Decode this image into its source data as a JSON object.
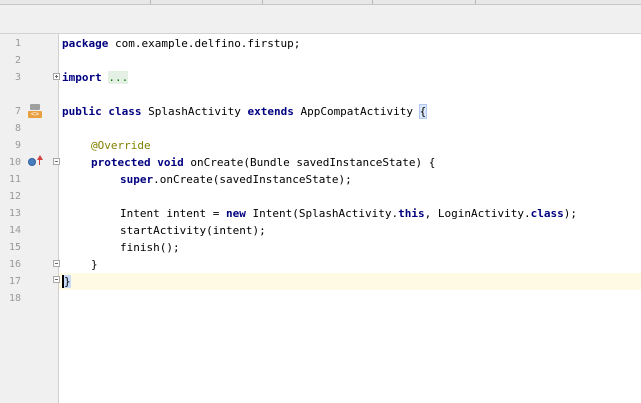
{
  "editor": {
    "lines": [
      {
        "n": "1",
        "code": "package com.example.delfino.firstup;"
      },
      {
        "n": "2",
        "code": ""
      },
      {
        "n": "3",
        "code": "import ..."
      },
      {
        "n": "7",
        "code": "public class SplashActivity extends AppCompatActivity {"
      },
      {
        "n": "8",
        "code": ""
      },
      {
        "n": "9",
        "code": "    @Override"
      },
      {
        "n": "10",
        "code": "    protected void onCreate(Bundle savedInstanceState) {"
      },
      {
        "n": "11",
        "code": "        super.onCreate(savedInstanceState);"
      },
      {
        "n": "12",
        "code": ""
      },
      {
        "n": "13",
        "code": "        Intent intent = new Intent(SplashActivity.this, LoginActivity.class);"
      },
      {
        "n": "14",
        "code": "        startActivity(intent);"
      },
      {
        "n": "15",
        "code": "        finish();"
      },
      {
        "n": "16",
        "code": "    }"
      },
      {
        "n": "17",
        "code": "}"
      },
      {
        "n": "18",
        "code": ""
      }
    ],
    "tokens": {
      "l1_kw": "package",
      "l1_rest": " com.example.delfino.firstup;",
      "l3_kw": "import",
      "l3_sp": " ",
      "l3_fold": "...",
      "l7_kw1": "public",
      "l7_sp1": " ",
      "l7_kw2": "class",
      "l7_mid": " SplashActivity ",
      "l7_kw3": "extends",
      "l7_rest": " AppCompatActivity ",
      "l7_brace": "{",
      "l9_ann": "@Override",
      "l10_kw1": "protected",
      "l10_sp": " ",
      "l10_kw2": "void",
      "l10_rest": " onCreate(Bundle savedInstanceState) {",
      "l11_kw": "super",
      "l11_rest": ".onCreate(savedInstanceState);",
      "l13_a": "Intent intent = ",
      "l13_kw1": "new",
      "l13_b": " Intent(SplashActivity.",
      "l13_kw2": "this",
      "l13_c": ", LoginActivity.",
      "l13_kw3": "class",
      "l13_d": ");",
      "l14": "startActivity(intent);",
      "l15": "finish();",
      "l16": "}",
      "l17": "}"
    }
  },
  "gutter_icons": {
    "line7": "android-activity-icon",
    "line10": "override-method-icon"
  },
  "colors": {
    "keyword": "#000080",
    "annotation": "#808000",
    "fold_text": "#008000",
    "current_line": "#fffae3",
    "gutter": "#f0f0f0"
  }
}
